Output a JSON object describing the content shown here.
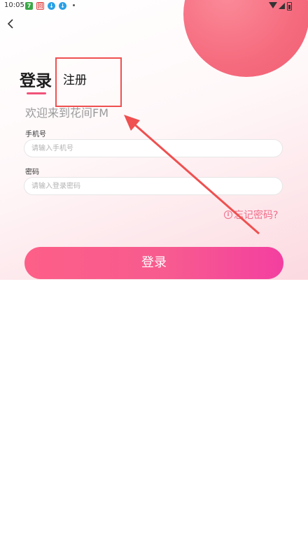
{
  "status_bar": {
    "time": "10:05",
    "app_icons": [
      "app-7-icon",
      "app-stamp-icon",
      "download-icon",
      "download-icon"
    ],
    "app_icon_glyphs": [
      "7",
      "回",
      "↓",
      "↓"
    ]
  },
  "tabs": {
    "login_label": "登录",
    "register_label": "注册"
  },
  "welcome_text": "欢迎来到花间FM",
  "form": {
    "phone_label": "手机号",
    "phone_placeholder": "请输入手机号",
    "password_label": "密码",
    "password_placeholder": "请输入登录密码"
  },
  "forgot_password": {
    "icon": "info-icon",
    "icon_glyph": "i",
    "label": "忘记密码?"
  },
  "login_button_label": "登录",
  "colors": {
    "accent": "#f0537a",
    "button_start": "#fd5f88",
    "button_end": "#f33fa0",
    "circle": "#f56b7e",
    "annotation": "#ef5050"
  }
}
